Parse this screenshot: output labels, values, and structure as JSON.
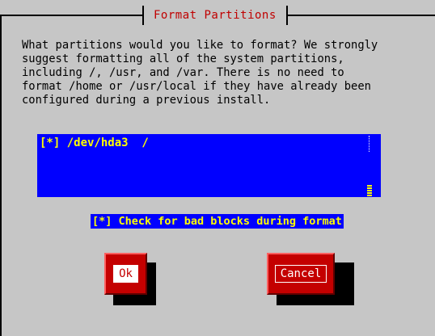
{
  "dialog": {
    "title": "Format Partitions",
    "message": "What partitions would you like to format? We strongly\nsuggest formatting all of the system partitions,\nincluding /, /usr, and /var. There is no need to\nformat /home or /usr/local if they have already been\nconfigured during a previous install."
  },
  "partitions": [
    {
      "label": "[*] /dev/hda3  /"
    }
  ],
  "bad_blocks_check": {
    "label": "[*] Check for bad blocks during format"
  },
  "buttons": {
    "ok": "Ok",
    "cancel": "Cancel"
  },
  "colors": {
    "background": "#c6c6c6",
    "list_background": "#0000ff",
    "list_text": "#ffff00",
    "button": "#c40000",
    "title": "#c00000"
  }
}
